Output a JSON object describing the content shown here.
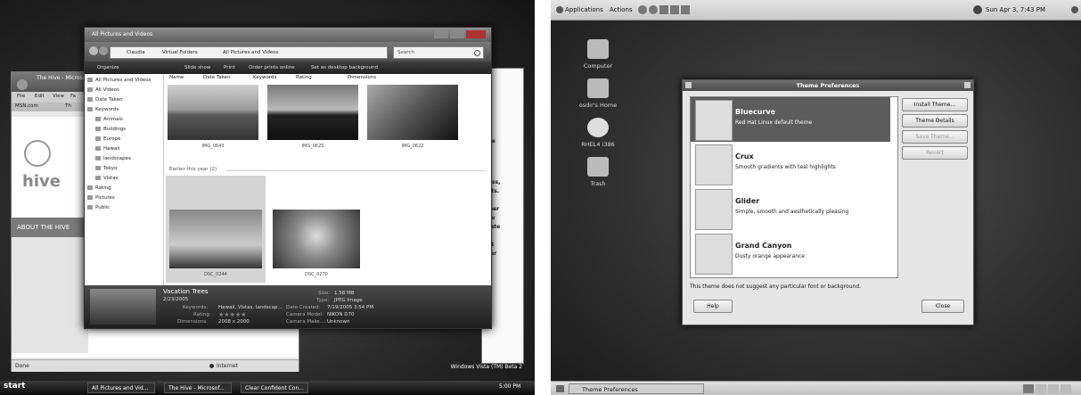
{
  "vista": {
    "ie": {
      "title": "The Hive - Microsoft Internet Explorer",
      "menu": [
        "File",
        "Edit",
        "View",
        "Fa"
      ],
      "tabs": [
        "MSN.com",
        "Th"
      ],
      "logo": "hive",
      "banner": "ABOUT THE HIVE",
      "side_text": [
        "fine",
        "at",
        "tless,",
        "ents.",
        "at",
        "rtner",
        "you",
        "brate",
        "at",
        "nat",
        "ther"
      ],
      "status_left": "Done",
      "status_zone": "Internet"
    },
    "explorer": {
      "title": "All Pictures and Videos",
      "breadcrumb": [
        "Claudia",
        "Virtual Folders",
        "All Pictures and Videos"
      ],
      "search_placeholder": "Search",
      "commands": [
        "Organize",
        "Slide show",
        "Print",
        "Order prints online",
        "Set as desktop background"
      ],
      "nav": [
        {
          "label": "All Pictures and Videos",
          "indent": 0
        },
        {
          "label": "All Videos",
          "indent": 0
        },
        {
          "label": "Date Taken",
          "indent": 0
        },
        {
          "label": "Keywords",
          "indent": 0
        },
        {
          "label": "Animals",
          "indent": 1
        },
        {
          "label": "Buildings",
          "indent": 1
        },
        {
          "label": "Europe",
          "indent": 1
        },
        {
          "label": "Hawaii",
          "indent": 1
        },
        {
          "label": "landscapes",
          "indent": 1
        },
        {
          "label": "Tokyo",
          "indent": 1
        },
        {
          "label": "Vistas",
          "indent": 1
        },
        {
          "label": "Rating",
          "indent": 0
        },
        {
          "label": "Pictures",
          "indent": 0
        },
        {
          "label": "Public",
          "indent": 0
        }
      ],
      "columns": [
        "Name",
        "Date Taken",
        "Keywords",
        "Rating",
        "Dimensions"
      ],
      "top_thumbs": [
        "IMG_0643",
        "IMG_0625",
        "IMG_0622"
      ],
      "group_header": "Earlier this year (2)",
      "bottom_thumbs": [
        "DSC_0244",
        "DSC_0270"
      ],
      "details": {
        "name": "Vacation Trees",
        "date": "2/23/2005",
        "keywords_label": "Keywords:",
        "keywords": "Hawaii, Vistas, landscap...",
        "rating_label": "Rating:",
        "rating": "★★★★★",
        "dimensions_label": "Dimensions:",
        "dimensions": "2008 x 2000",
        "size_label": "Size:",
        "size": "1.58 MB",
        "type_label": "Type:",
        "type": "JPEG Image",
        "created_label": "Date Created:",
        "created": "7/19/2005 3:54 PM",
        "camera_label": "Camera Model:",
        "camera": "NIKON D70",
        "maker_label": "Camera Make...:",
        "maker": "Unknown"
      }
    },
    "brand": "Windows Vista (TM) Beta 2",
    "taskbar": {
      "start": "start",
      "items": [
        "All Pictures and Vid...",
        "The Hive - Microsof...",
        "Clear Confident Con..."
      ],
      "clock": "5:00 PM"
    }
  },
  "gnome": {
    "panel": {
      "menus": [
        "Applications",
        "Actions"
      ],
      "clock": "Sun Apr 3, 7:43 PM"
    },
    "desktop_icons": [
      "Computer",
      "osdir's Home",
      "RHEL4 i386",
      "Trash"
    ],
    "dialog": {
      "title": "Theme Preferences",
      "themes": [
        {
          "name": "Bluecurve",
          "desc": "Red Hat Linux default theme"
        },
        {
          "name": "Crux",
          "desc": "Smooth gradients with teal highlights"
        },
        {
          "name": "Glider",
          "desc": "Simple, smooth and aesthetically pleasing"
        },
        {
          "name": "Grand Canyon",
          "desc": "Dusty orange appearance"
        }
      ],
      "buttons": {
        "install": "Install Theme...",
        "details": "Theme Details",
        "save": "Save Theme...",
        "revert": "Revert",
        "help": "Help",
        "close": "Close"
      },
      "message": "This theme does not suggest any particular font or background."
    },
    "taskbar_item": "Theme Preferences"
  }
}
